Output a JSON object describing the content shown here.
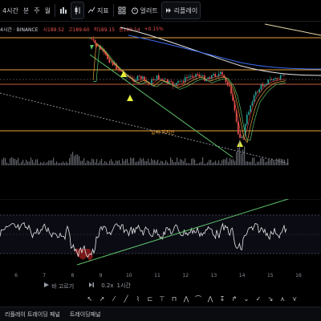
{
  "toolbar": {
    "interval": "4시간",
    "interval_icon": "dropdown-icon",
    "items": [
      {
        "label": "분",
        "name": "toolbar-item-minute"
      },
      {
        "label": "주",
        "name": "toolbar-item-week"
      },
      {
        "label": "월",
        "name": "toolbar-item-month"
      }
    ],
    "indicators_label": "지표",
    "layout_label": "레이아웃",
    "alerts_label": "얼러트",
    "replay_label": "리플레이"
  },
  "legend": {
    "symbol": "4시간 · BINANCE",
    "values": [
      "시189.52",
      "고189.60",
      "저189.15",
      "종189.54",
      "+0.15%"
    ]
  },
  "chart_text": {
    "support_label": "벌써-지지선"
  },
  "x_axis": {
    "ticks": [
      "6",
      "7",
      "8",
      "9",
      "10",
      "11",
      "12",
      "13",
      "14",
      "15",
      "16"
    ]
  },
  "time_nav": {
    "goto_label": "바 고르기",
    "speed_label": "0.2x",
    "step_label": "1시간"
  },
  "bottom_tabs": [
    {
      "label": "리플레이 트레이딩 패널"
    },
    {
      "label": "트레이딩패널"
    }
  ],
  "colors": {
    "up": "#26a69a",
    "down": "#ef5350",
    "level_line": "#e8a23a",
    "ma_blue": "#3b6cf0",
    "ma_white": "#e6e6e6",
    "trend_green": "#5cc06a"
  }
}
